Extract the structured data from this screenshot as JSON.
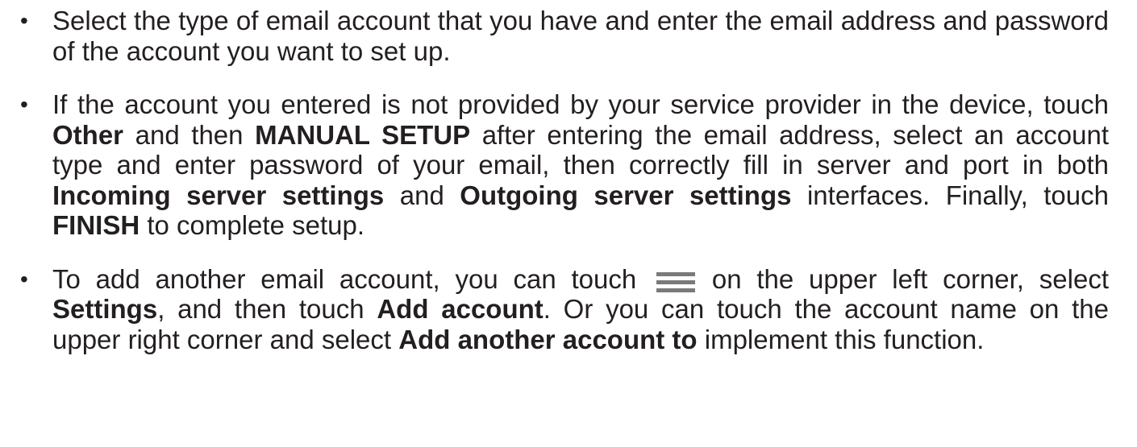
{
  "bullets": [
    {
      "segments": [
        {
          "text": "Select the type of email account that you have and enter the email address and password of the account you want to set up.",
          "bold": false
        }
      ]
    },
    {
      "segments": [
        {
          "text": "If the account you entered is not provided by your service provider in the device, touch ",
          "bold": false
        },
        {
          "text": "Other",
          "bold": true
        },
        {
          "text": " and then ",
          "bold": false
        },
        {
          "text": "MANUAL SETUP",
          "bold": true
        },
        {
          "text": " after entering the email address, select an account type and enter password of your email, then correctly fill in server and port in both ",
          "bold": false
        },
        {
          "text": "Incoming server settings",
          "bold": true
        },
        {
          "text": " and ",
          "bold": false
        },
        {
          "text": "Outgoing server settings",
          "bold": true
        },
        {
          "text": " interfaces. Finally, touch ",
          "bold": false
        },
        {
          "text": "FINISH",
          "bold": true
        },
        {
          "text": " to complete setup.",
          "bold": false
        }
      ]
    },
    {
      "segments": [
        {
          "text": "To add another email account, you can touch ",
          "bold": false
        },
        {
          "text": " on the upper left corner, select ",
          "bold": false
        },
        {
          "text": "Settings",
          "bold": true
        },
        {
          "text": ", and then touch ",
          "bold": false
        },
        {
          "text": "Add account",
          "bold": true
        },
        {
          "text": ". Or you can touch the account name on the upper right corner and select ",
          "bold": false
        },
        {
          "text": "Add another account to",
          "bold": true
        },
        {
          "text": " implement this function.",
          "bold": false
        }
      ],
      "icon": "menu-icon",
      "icon_color": "#7a7a7a"
    }
  ],
  "bullet_glyph": "•",
  "text_color": "#231f20"
}
